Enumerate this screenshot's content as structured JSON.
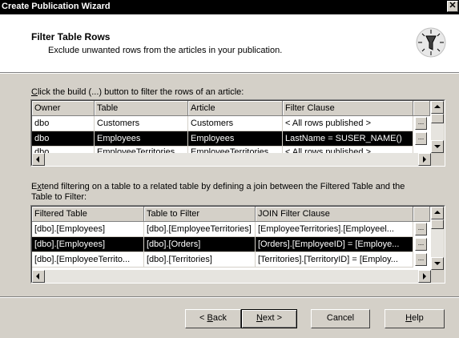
{
  "window": {
    "title": "Create Publication Wizard",
    "close_glyph": "✕"
  },
  "header": {
    "title": "Filter Table Rows",
    "subtitle": "Exclude unwanted rows from the articles in your publication.",
    "icon": "wizard-filter-icon"
  },
  "section1": {
    "label_key": "C",
    "label_rest": "lick the build (...) button to filter the rows of an article:",
    "columns": [
      "Owner",
      "Table",
      "Article",
      "Filter Clause"
    ],
    "rows": [
      {
        "owner": "dbo",
        "table": "Customers",
        "article": "Customers",
        "filter": "< All rows published >"
      },
      {
        "owner": "dbo",
        "table": "Employees",
        "article": "Employees",
        "filter": "LastName = SUSER_NAME()"
      },
      {
        "owner": "dbo",
        "table": "EmployeeTerritories",
        "article": "EmployeeTerritories",
        "filter": "< All rows published >"
      }
    ],
    "selected_row": 1,
    "build_label": "..."
  },
  "section2": {
    "label_line1_key": "x",
    "label_line1_pre": "E",
    "label_line1_rest": "tend filtering on a table to a related table by defining a join between the Filtered Table and the",
    "label_line2": "Table to Filter:",
    "columns": [
      "Filtered Table",
      "Table to Filter",
      "JOIN Filter Clause"
    ],
    "rows": [
      {
        "filtered": "[dbo].[Employees]",
        "to_filter": "[dbo].[EmployeeTerritories]",
        "clause": "[EmployeeTerritories].[Employeel..."
      },
      {
        "filtered": "[dbo].[Employees]",
        "to_filter": "[dbo].[Orders]",
        "clause": "[Orders].[EmployeeID] = [Employe..."
      },
      {
        "filtered": "[dbo].[EmployeeTerrito...",
        "to_filter": "[dbo].[Territories]",
        "clause": "[Territories].[TerritoryID] = [Employ..."
      }
    ],
    "selected_row": 1,
    "build_label": "..."
  },
  "buttons": {
    "back_pre": "< ",
    "back_key": "B",
    "back_rest": "ack",
    "next_key": "N",
    "next_rest": "ext >",
    "cancel": "Cancel",
    "help_key": "H",
    "help_rest": "elp"
  }
}
